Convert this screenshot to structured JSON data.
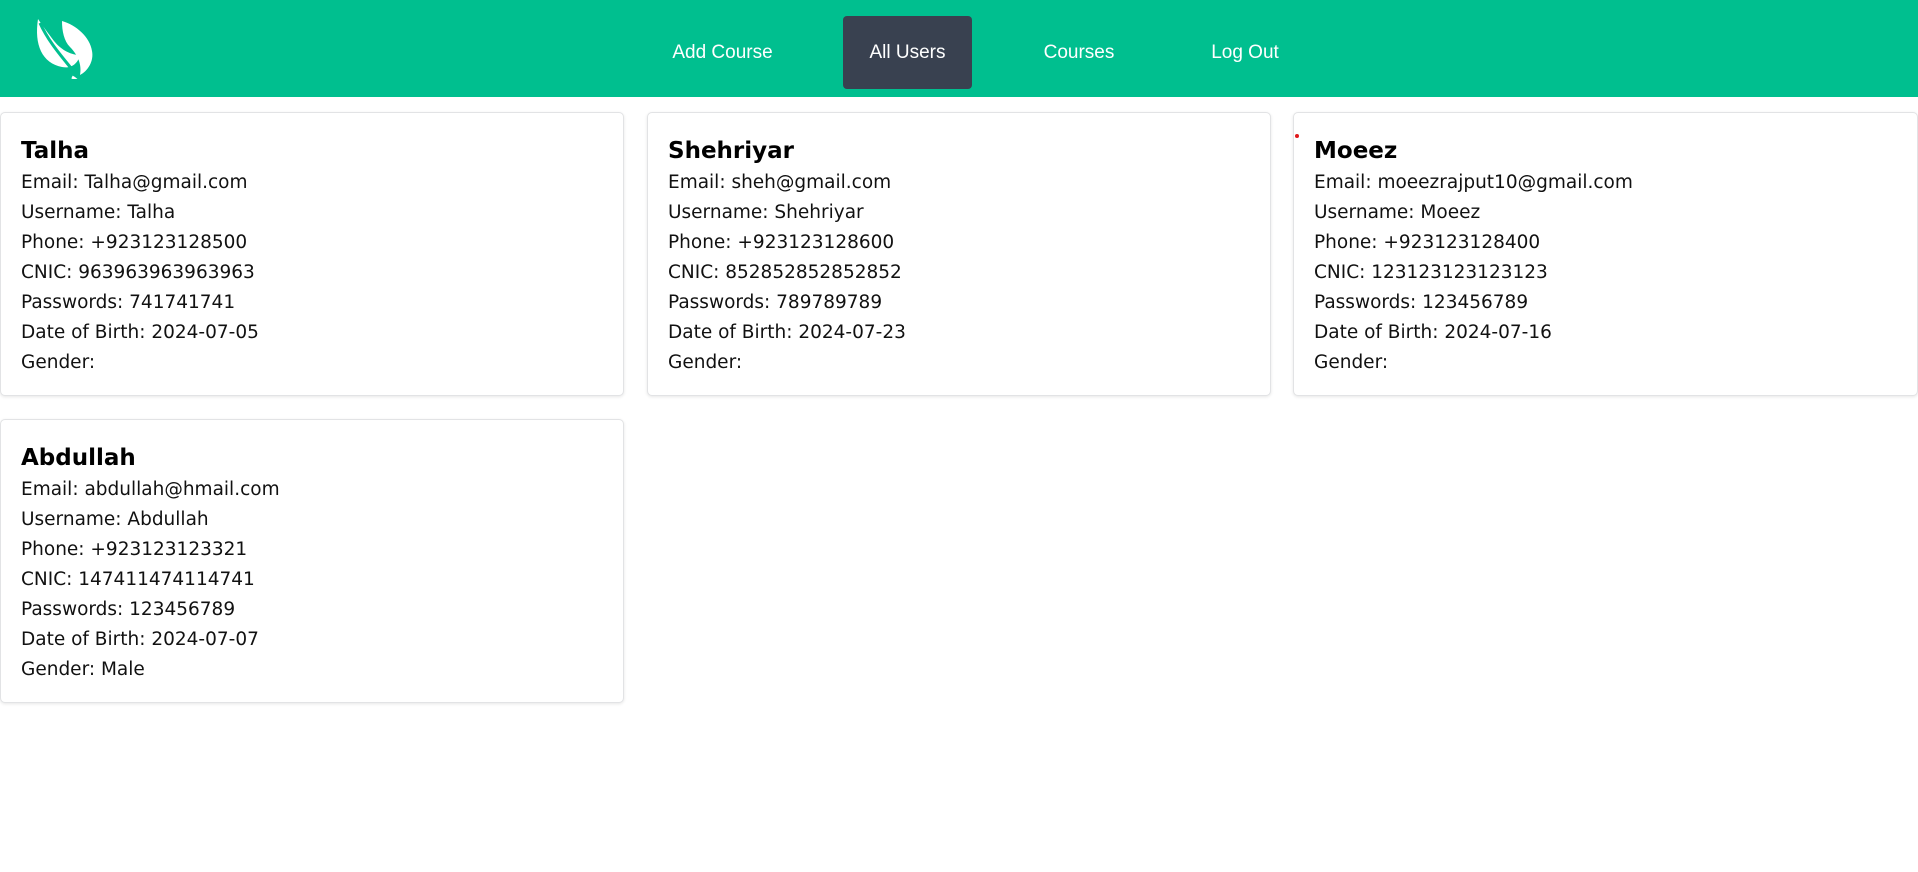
{
  "nav": {
    "items": [
      {
        "label": "Add Course",
        "active": false
      },
      {
        "label": "All Users",
        "active": true
      },
      {
        "label": "Courses",
        "active": false
      },
      {
        "label": "Log Out",
        "active": false
      }
    ],
    "brand_color": "#00bf8f",
    "active_color": "#394150",
    "logo_icon": "leaf-icon"
  },
  "users": [
    {
      "name": "Talha",
      "email": "Email: Talha@gmail.com",
      "username": "Username: Talha",
      "phone": "Phone: +923123128500",
      "cnic": "CNIC: 963963963963963",
      "passwords": "Passwords: 741741741",
      "dob": "Date of Birth: 2024-07-05",
      "gender": "Gender:"
    },
    {
      "name": "Shehriyar",
      "email": "Email: sheh@gmail.com",
      "username": "Username: Shehriyar",
      "phone": "Phone: +923123128600",
      "cnic": "CNIC: 852852852852852",
      "passwords": "Passwords: 789789789",
      "dob": "Date of Birth: 2024-07-23",
      "gender": "Gender:"
    },
    {
      "name": "Moeez",
      "email": "Email: moeezrajput10@gmail.com",
      "username": "Username: Moeez",
      "phone": "Phone: +923123128400",
      "cnic": "CNIC: 123123123123123",
      "passwords": "Passwords: 123456789",
      "dob": "Date of Birth: 2024-07-16",
      "gender": "Gender:"
    },
    {
      "name": "Abdullah",
      "email": "Email: abdullah@hmail.com",
      "username": "Username: Abdullah",
      "phone": "Phone: +923123123321",
      "cnic": "CNIC: 147411474114741",
      "passwords": "Passwords: 123456789",
      "dob": "Date of Birth: 2024-07-07",
      "gender": "Gender: Male"
    }
  ]
}
